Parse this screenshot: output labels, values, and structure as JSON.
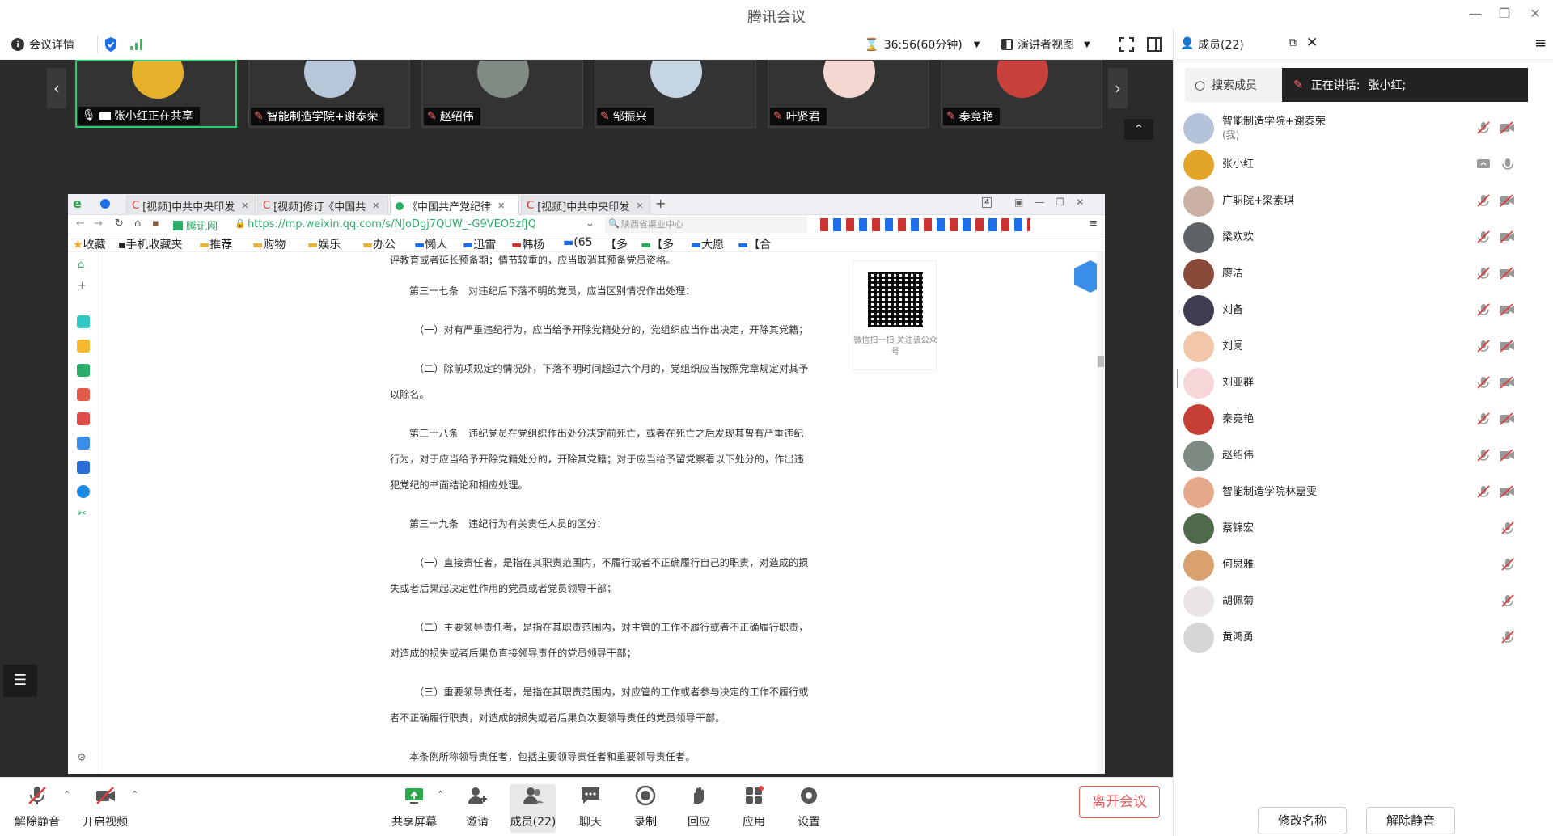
{
  "window": {
    "title": "腾讯会议"
  },
  "toolbar": {
    "meeting_details": "会议详情",
    "timer": "36:56(60分钟)",
    "view_mode": "演讲者视图"
  },
  "video_strip": [
    {
      "name": "张小红正在共享",
      "active": true,
      "color": "#e7b12a"
    },
    {
      "name": "智能制造学院+谢泰荣",
      "active": false,
      "color": "#b8c6da"
    },
    {
      "name": "赵绍伟",
      "active": false,
      "color": "#7f8b83"
    },
    {
      "name": "邹振兴",
      "active": false,
      "color": "#c7d6e3"
    },
    {
      "name": "叶贤君",
      "active": false,
      "color": "#f3d7d0"
    },
    {
      "name": "秦竞艳",
      "active": false,
      "color": "#c9413b"
    }
  ],
  "browser": {
    "tabs": [
      {
        "label": "[视频]中共中央印发"
      },
      {
        "label": "[视频]修订《中国共"
      },
      {
        "label": "《中国共产党纪律"
      },
      {
        "label": "[视频]中共中央印发"
      }
    ],
    "tab_count": "4",
    "site_label": "腾讯网",
    "url": "https://mp.weixin.qq.com/s/NJoDgj7QUW_-G9VEO5zfJQ",
    "search_placeholder": "陕西省渠业中心",
    "bookmarks": [
      "收藏",
      "手机收藏夹",
      "推荐",
      "购物",
      "娱乐",
      "办公",
      "懒人",
      "迅雷",
      "韩杨",
      "(65",
      "【多",
      "【多",
      "大愿",
      "【合"
    ],
    "article": [
      "评教育或者延长预备期；情节较重的，应当取消其预备党员资格。",
      "第三十七条　对违纪后下落不明的党员，应当区别情况作出处理：",
      "（一）对有严重违纪行为，应当给予开除党籍处分的，党组织应当作出决定，开除其党籍；",
      "（二）除前项规定的情况外，下落不明时间超过六个月的，党组织应当按照党章规定对其予",
      "以除名。",
      "第三十八条　违纪党员在党组织作出处分决定前死亡，或者在死亡之后发现其曾有严重违纪",
      "行为，对于应当给予开除党籍处分的，开除其党籍；对于应当给予留党察看以下处分的，作出违",
      "犯党纪的书面结论和相应处理。",
      "第三十九条　违纪行为有关责任人员的区分：",
      "（一）直接责任者，是指在其职责范围内，不履行或者不正确履行自己的职责，对造成的损",
      "失或者后果起决定性作用的党员或者党员领导干部；",
      "（二）主要领导责任者，是指在其职责范围内，对主管的工作不履行或者不正确履行职责，",
      "对造成的损失或者后果负直接领导责任的党员领导干部；",
      "（三）重要领导责任者，是指在其职责范围内，对应管的工作或者参与决定的工作不履行或",
      "者不正确履行职责，对造成的损失或者后果负次要领导责任的党员领导干部。",
      "本条例所称领导责任者，包括主要领导责任者和重要领导责任者。"
    ],
    "qr_caption": "微信扫一扫 关注该公众号"
  },
  "controls": {
    "unmute": "解除静音",
    "start_video": "开启视频",
    "share_screen": "共享屏幕",
    "invite": "邀请",
    "members": "成员(22)",
    "chat": "聊天",
    "record": "录制",
    "react": "回应",
    "apps": "应用",
    "settings": "设置",
    "leave": "离开会议"
  },
  "panel": {
    "title": "成员(22)",
    "search_label": "搜索成员",
    "speaking_label": "正在讲话:",
    "speaking_name": "张小红;",
    "members": [
      {
        "name": "智能制造学院+谢泰荣",
        "sub": "(我)",
        "color": "#b4c3d8",
        "icons": "mic-off+video-off"
      },
      {
        "name": "张小红",
        "sub": "",
        "color": "#e2a52a",
        "icons": "share+mic"
      },
      {
        "name": "广职院+梁素琪",
        "sub": "",
        "color": "#c9b2a4",
        "icons": "mic-off+video-off"
      },
      {
        "name": "梁欢欢",
        "sub": "",
        "color": "#5c6266",
        "icons": "mic-off+video-off"
      },
      {
        "name": "廖洁",
        "sub": "",
        "color": "#8a4a3a",
        "icons": "mic-off+video-off"
      },
      {
        "name": "刘备",
        "sub": "",
        "color": "#3e3d52",
        "icons": "mic-off+video-off"
      },
      {
        "name": "刘阑",
        "sub": "",
        "color": "#f1c6a9",
        "icons": "mic-off+video-off"
      },
      {
        "name": "刘亚群",
        "sub": "",
        "color": "#f6d6d8",
        "icons": "mic-off+video-off"
      },
      {
        "name": "秦竟艳",
        "sub": "",
        "color": "#c63f36",
        "icons": "mic-off+video-off"
      },
      {
        "name": "赵绍伟",
        "sub": "",
        "color": "#7d8a82",
        "icons": "mic-off+video-off"
      },
      {
        "name": "智能制造学院林嘉雯",
        "sub": "",
        "color": "#e6a88a",
        "icons": "mic-off+video-off"
      },
      {
        "name": "蔡锦宏",
        "sub": "",
        "color": "#4f6a4a",
        "icons": "mic-off"
      },
      {
        "name": "何思雅",
        "sub": "",
        "color": "#d9a070",
        "icons": "mic-off"
      },
      {
        "name": "胡佩菊",
        "sub": "",
        "color": "#eae4e6",
        "icons": "mic-off"
      },
      {
        "name": "黄鸿勇",
        "sub": "",
        "color": "#d6d6d6",
        "icons": "mic-off"
      }
    ],
    "rename_button": "修改名称",
    "unmute_button": "解除静音"
  },
  "colors": {
    "accent_green": "#2ecc71",
    "danger": "#e15a5a",
    "stage_bg": "#2b2b2b"
  }
}
